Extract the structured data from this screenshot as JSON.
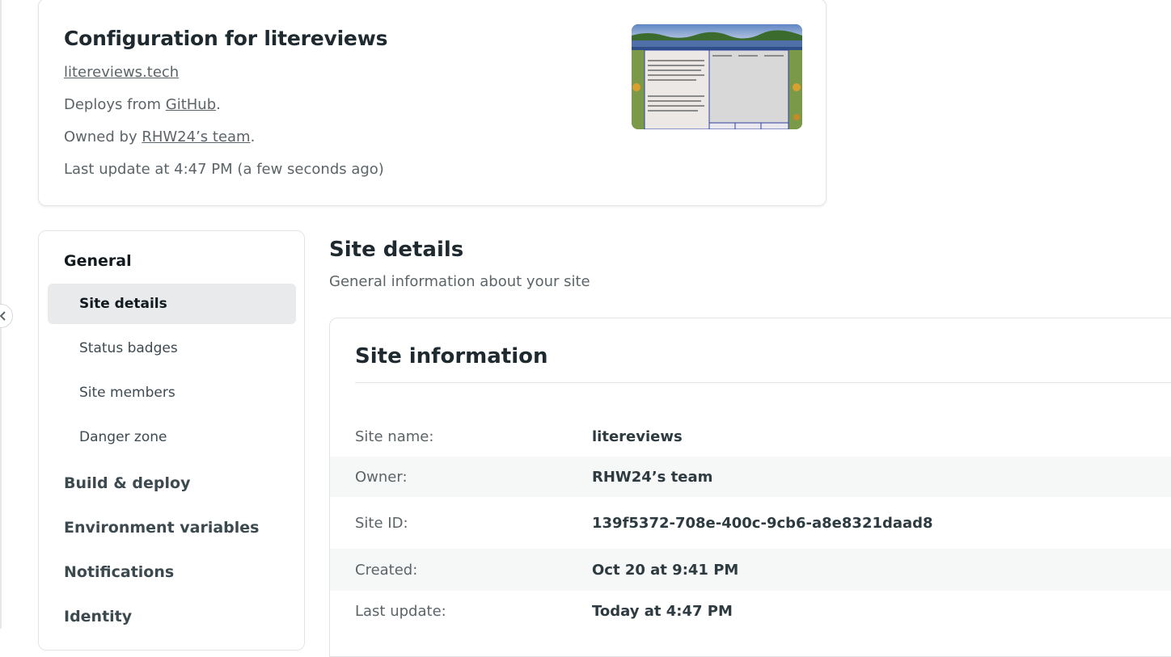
{
  "header": {
    "title": "Configuration for litereviews",
    "site_url": "litereviews.tech",
    "deploys_prefix": "Deploys from ",
    "deploys_link": "GitHub",
    "deploys_suffix": ".",
    "owned_prefix": "Owned by ",
    "owned_link": "RHW24’s team",
    "owned_suffix": ".",
    "last_update": "Last update at 4:47 PM (a few seconds ago)"
  },
  "sidebar": {
    "groups": [
      {
        "label": "General",
        "active": true
      },
      {
        "label": "Build & deploy"
      },
      {
        "label": "Environment variables"
      },
      {
        "label": "Notifications"
      },
      {
        "label": "Identity"
      }
    ],
    "general_items": [
      {
        "label": "Site details",
        "selected": true
      },
      {
        "label": "Status badges"
      },
      {
        "label": "Site members"
      },
      {
        "label": "Danger zone"
      }
    ]
  },
  "main": {
    "title": "Site details",
    "subtitle": "General information about your site",
    "card": {
      "title": "Site information",
      "rows": [
        {
          "key": "Site name:",
          "value": "litereviews"
        },
        {
          "key": "Owner:",
          "value": "RHW24’s team"
        },
        {
          "key": "Site ID:",
          "value": "139f5372-708e-400c-9cb6-a8e8321daad8"
        },
        {
          "key": "Created:",
          "value": "Oct 20 at 9:41 PM"
        },
        {
          "key": "Last update:",
          "value": "Today at 4:47 PM"
        }
      ]
    }
  },
  "icons": {
    "collapse": "chevron-left-icon",
    "thumbnail": "site-preview-thumbnail"
  }
}
